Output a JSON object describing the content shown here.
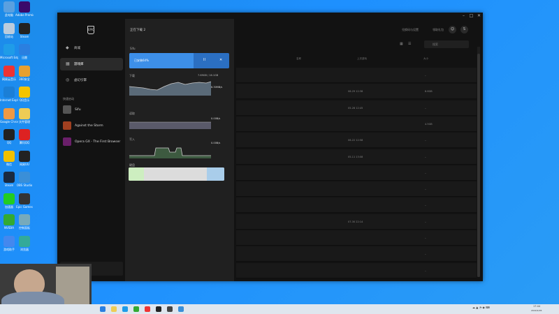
{
  "desktop": {
    "icons": [
      {
        "label": "此电脑",
        "color": "#5aa0e0"
      },
      {
        "label": "Adobe Premiere",
        "color": "#3a0a6a"
      },
      {
        "label": "回收站",
        "color": "#bcd"
      },
      {
        "label": "Steam",
        "color": "#222"
      },
      {
        "label": "Microsoft Edge",
        "color": "#1f9ce8"
      },
      {
        "label": "迅雷",
        "color": "#2a7fe0"
      },
      {
        "label": "网易云音乐",
        "color": "#e33"
      },
      {
        "label": "360安全",
        "color": "#e8a030"
      },
      {
        "label": "Internet Explorer",
        "color": "#1b7fd6"
      },
      {
        "label": "QQ音乐",
        "color": "#f5c400"
      },
      {
        "label": "Google Chrome",
        "color": "#e94"
      },
      {
        "label": "文件管理",
        "color": "#ec5"
      },
      {
        "label": "QQ",
        "color": "#222"
      },
      {
        "label": "腾讯QQ",
        "color": "#d22"
      },
      {
        "label": "微信",
        "color": "#f0c000"
      },
      {
        "label": "网易UU",
        "color": "#222"
      },
      {
        "label": "Steam",
        "color": "#1a2a40"
      },
      {
        "label": "OBS Studio",
        "color": "#3a8fd8"
      },
      {
        "label": "加速器",
        "color": "#2c2"
      },
      {
        "label": "Epic Games",
        "color": "#333"
      },
      {
        "label": "NVIDIA",
        "color": "#3a3"
      },
      {
        "label": "控制面板",
        "color": "#7ab"
      },
      {
        "label": "游戏助手",
        "color": "#48e"
      },
      {
        "label": "浏览器",
        "color": "#3a9"
      }
    ]
  },
  "window": {
    "controls": {
      "minimize": "–",
      "maximize": "□",
      "close": "✕"
    }
  },
  "sidebar": {
    "logo_text": "EPIC",
    "nav": [
      {
        "label": "商城",
        "icon": "tag-icon"
      },
      {
        "label": "游戏库",
        "icon": "grid-icon"
      },
      {
        "label": "虚幻引擎",
        "icon": "unreal-icon"
      }
    ],
    "favorites_label": "快速启动",
    "favorites": [
      {
        "label": "Sifu",
        "color": "#555"
      },
      {
        "label": "Against the Storm",
        "color": "#a04020"
      },
      {
        "label": "Opera GX - The First Browser",
        "color": "#6a1f6a"
      }
    ]
  },
  "downloads": {
    "title": "正在下载  2",
    "game": "Sifu",
    "progress_status": "已安装64%",
    "progress_fraction": 0.64,
    "pause_icon": "II",
    "cancel_icon": "✕",
    "download_label": "下载",
    "download_extra": "7.69GB / 16.1GB",
    "download_rate": "6.30MB/s",
    "disk_read_label": "读取",
    "disk_read_rate": "0.00B/s",
    "disk_write_label": "写入",
    "disk_write_rate": "0.00B/s",
    "disk_label": "硬盘"
  },
  "main": {
    "top_links": [
      "兑换码与设置",
      "领取礼包"
    ],
    "search_placeholder": "搜索",
    "columns": [
      "名称",
      "上次游玩",
      "大小"
    ],
    "rows": [
      {
        "name": "",
        "played": "",
        "size": "–"
      },
      {
        "name": "",
        "played": "08-29 12:38",
        "size": "8.6GB"
      },
      {
        "name": "",
        "played": "05-28 12:45",
        "size": "–"
      },
      {
        "name": "",
        "played": "",
        "size": "4.5GB"
      },
      {
        "name": "",
        "played": "06-22 12:58",
        "size": "–"
      },
      {
        "name": "",
        "played": "05-11 13:08",
        "size": "–"
      },
      {
        "name": "",
        "played": "",
        "size": "–"
      },
      {
        "name": "",
        "played": "",
        "size": "–"
      },
      {
        "name": "",
        "played": "",
        "size": "–"
      },
      {
        "name": "",
        "played": "07-30 22:14",
        "size": "–"
      },
      {
        "name": "",
        "played": "",
        "size": "–"
      },
      {
        "name": "",
        "played": "",
        "size": "–"
      },
      {
        "name": "",
        "played": "",
        "size": "–"
      }
    ]
  },
  "taskbar": {
    "apps": [
      "#2a7fe0",
      "#ec5",
      "#1f9ce8",
      "#3a3",
      "#e33",
      "#222",
      "#444",
      "#3a8fd8"
    ],
    "time": "17:44",
    "date": "2022/2/26"
  }
}
